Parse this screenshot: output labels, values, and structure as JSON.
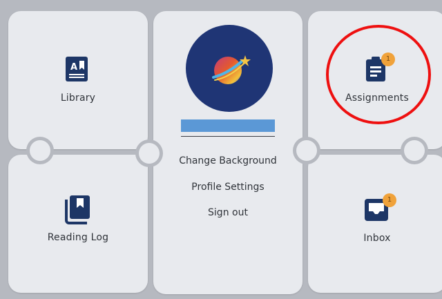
{
  "tiles": {
    "library": {
      "label": "Library"
    },
    "reading_log": {
      "label": "Reading Log"
    },
    "assignments": {
      "label": "Assignments",
      "badge": "1"
    },
    "inbox": {
      "label": "Inbox",
      "badge": "1"
    }
  },
  "profile_menu": {
    "change_background": "Change Background",
    "profile_settings": "Profile Settings",
    "sign_out": "Sign out"
  },
  "colors": {
    "background": "#b6b9c0",
    "tile": "#e8eaee",
    "icon_navy": "#1d3666",
    "badge_orange": "#f0a23a",
    "avatar_navy": "#1f3575",
    "name_bar_blue": "#5b98d6",
    "highlight_red": "#ee1010"
  },
  "icons": {
    "library": "book-letter-icon",
    "reading_log": "bookmark-books-icon",
    "assignments": "clipboard-icon",
    "inbox": "inbox-tray-icon",
    "avatar": "planet-avatar-icon"
  }
}
